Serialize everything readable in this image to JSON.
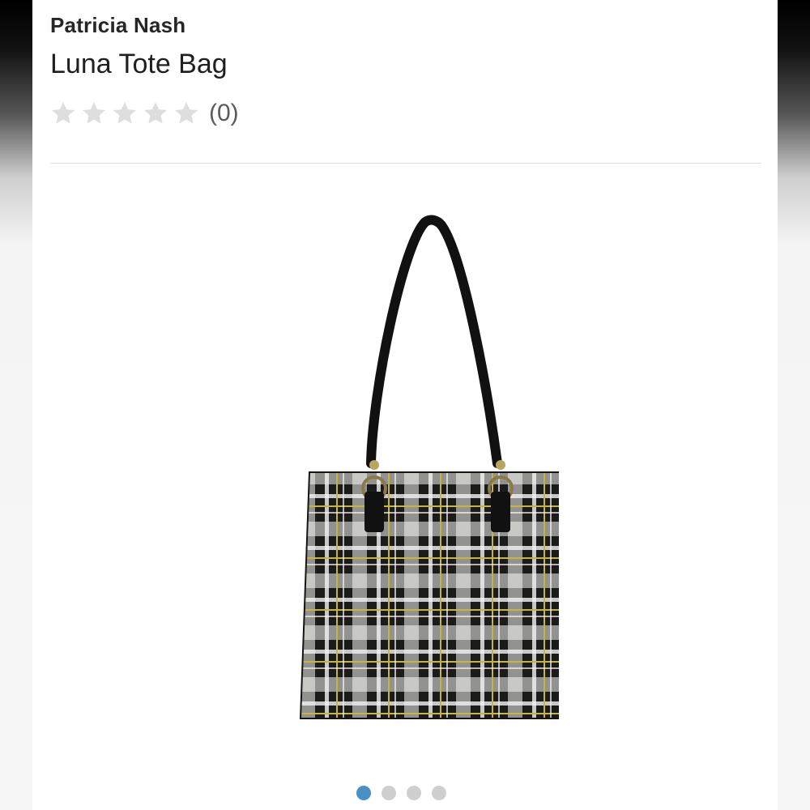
{
  "product": {
    "brand": "Patricia Nash",
    "name": "Luna Tote Bag",
    "rating": {
      "value": 0,
      "max": 5,
      "count_label": "(0)"
    },
    "image": {
      "icon": "plaid-tote-bag-image",
      "plaid_colors": [
        "#1b1b1b",
        "#f4f4f0",
        "#c9b53a"
      ]
    }
  },
  "carousel": {
    "total": 4,
    "active": 1,
    "active_color": "#4a90c4",
    "inactive_color": "#cfcfcf"
  },
  "colors": {
    "star_empty": "#dedede",
    "divider": "#dcdcdc"
  }
}
